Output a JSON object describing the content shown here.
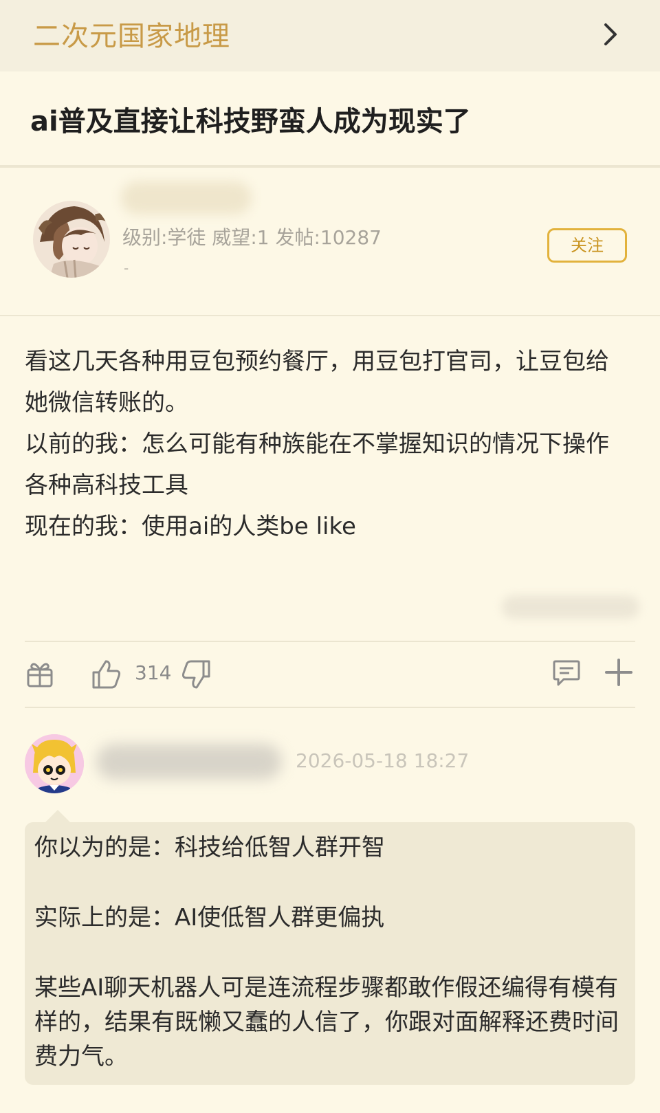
{
  "header": {
    "forum_name": "二次元国家地理"
  },
  "post": {
    "title": "ai普及直接让科技野蛮人成为现实了",
    "author": {
      "stats": "级别:学徒 威望:1 发帖:10287",
      "extra": "-",
      "follow_label": "关注"
    },
    "body": [
      "看这几天各种用豆包预约餐厅，用豆包打官司，让豆包给她微信转账的。",
      "以前的我：怎么可能有种族能在不掌握知识的情况下操作各种高科技工具",
      "现在的我：使用ai的人类be like"
    ],
    "actions": {
      "like_count": "314"
    }
  },
  "reply": {
    "timestamp": "2026-05-18 18:27",
    "paragraphs": [
      "你以为的是：科技给低智人群开智",
      "实际上的是：AI使低智人群更偏执",
      "某些AI聊天机器人可是连流程步骤都敢作假还编得有模有样的，结果有既懒又蠢的人信了，你跟对面解释还费时间费力气。"
    ]
  },
  "icons": [
    "chevron-right-icon",
    "gift-icon",
    "thumbs-up-icon",
    "thumbs-down-icon",
    "comment-icon",
    "plus-icon"
  ],
  "colors": {
    "background": "#fdf8e6",
    "header_bg": "#f4efde",
    "forum_name": "#c89a47",
    "follow_border": "#e2b23c",
    "bubble_bg": "#efe9d4"
  }
}
